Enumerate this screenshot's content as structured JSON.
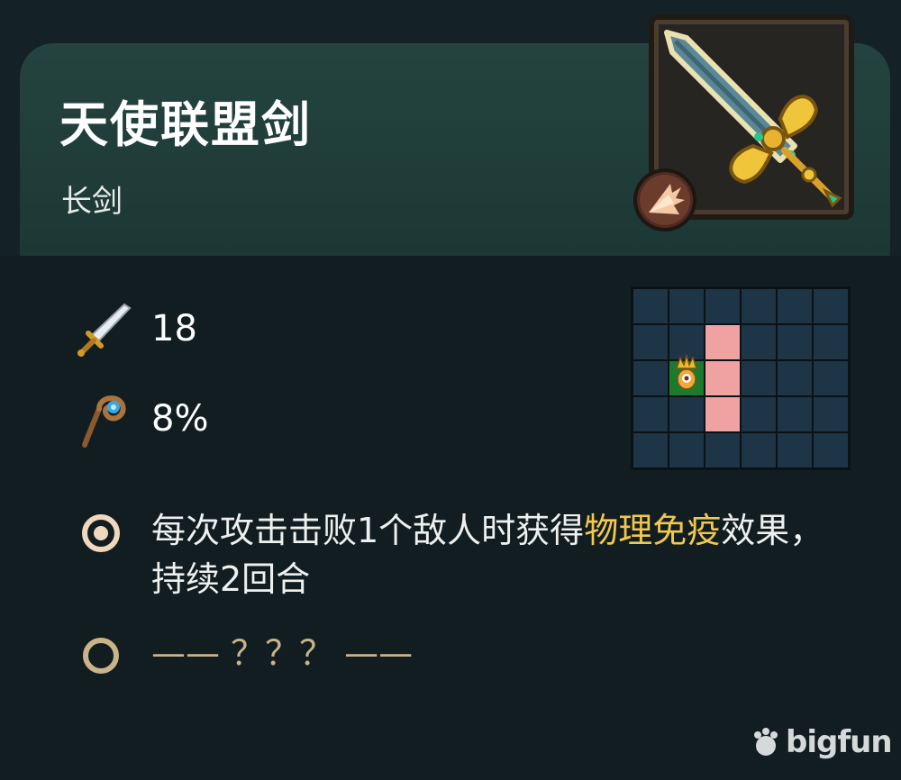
{
  "item": {
    "name": "天使联盟剑",
    "type": "长剑",
    "image_icon": "angel-alliance-sword-icon",
    "type_icon": "slash-burst-icon"
  },
  "stats": [
    {
      "icon": "sword-attack-icon",
      "value": "18"
    },
    {
      "icon": "crit-staff-icon",
      "value": "8%"
    }
  ],
  "attack_grid": {
    "columns": 6,
    "rows": 5,
    "self_cell": [
      1,
      2
    ],
    "hit_cells": [
      [
        2,
        1
      ],
      [
        2,
        2
      ],
      [
        2,
        3
      ]
    ]
  },
  "effects": [
    {
      "icon": "filled-ring-icon",
      "text_before": "每次攻击击败1个敌人时获得",
      "highlight": "物理免疫",
      "text_after": "效果，持续2回合"
    },
    {
      "icon": "empty-ring-icon",
      "text": "—— ？？？ ——"
    }
  ],
  "watermark": "bigfun",
  "colors": {
    "highlight": "#f2c84b",
    "hit_cell": "#f0a1a1",
    "self_cell": "#1c7a2d",
    "grid_cell": "#1e3447",
    "header_bg": "#24433f"
  }
}
